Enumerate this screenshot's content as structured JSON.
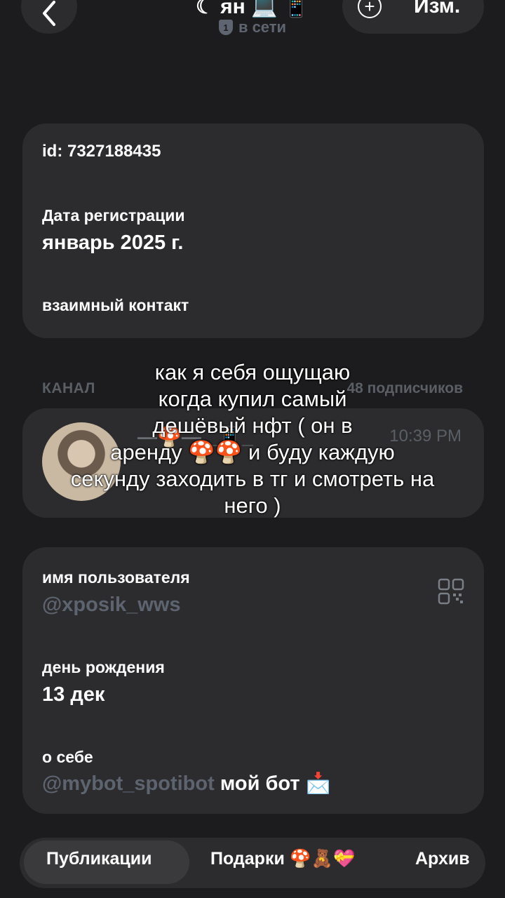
{
  "header": {
    "title": "☾ ян 💻 📱",
    "status_badge": "1",
    "status": "в сети",
    "edit_label": "Изм."
  },
  "info": {
    "id_text": "id: 7327188435",
    "reg_label": "Дата регистрации",
    "reg_value": "январь 2025 г.",
    "mutual": "взаимный контакт"
  },
  "channel": {
    "header": "КАНАЛ",
    "subscribers": "48 подписчиков",
    "name": "—🍄— _📱_",
    "time": "10:39 PM"
  },
  "profile": {
    "username_label": "имя пользователя",
    "username": "@xposik_wws",
    "birthday_label": "день рождения",
    "birthday": "13 дек",
    "about_label": "о себе",
    "about_link": "@mybot_spotibot",
    "about_text": " мой бот 📩"
  },
  "tabs": {
    "posts": "Публикации",
    "gifts": "Подарки 🍄🧸💝",
    "archive": "Архив"
  },
  "caption": {
    "line1": "как я себя ощущаю",
    "line2": "когда купил самый",
    "line3": "дешёвый нфт ( он в",
    "line4": "аренду 🍄🍄 и буду каждую",
    "line5": "секунду заходить в тг и смотреть на",
    "line6": "него )"
  }
}
